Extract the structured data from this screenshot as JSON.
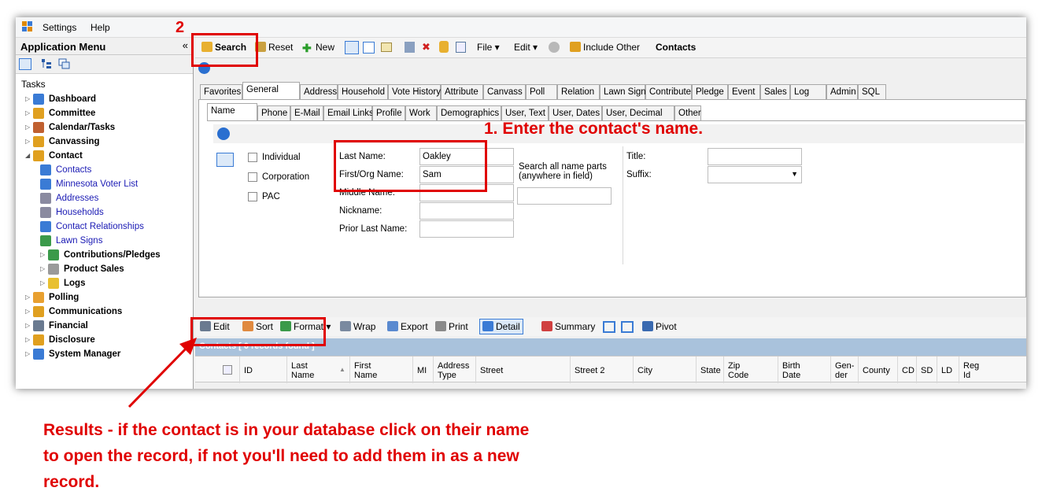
{
  "menu": {
    "settings": "Settings",
    "help": "Help"
  },
  "left": {
    "title": "Application Menu",
    "collapse": "«",
    "tasks": "Tasks",
    "tree": [
      {
        "label": "Dashboard",
        "level": 0,
        "bold": true,
        "exp": "▷"
      },
      {
        "label": "Committee",
        "level": 0,
        "bold": true,
        "exp": "▷"
      },
      {
        "label": "Calendar/Tasks",
        "level": 0,
        "bold": true,
        "exp": "▷"
      },
      {
        "label": "Canvassing",
        "level": 0,
        "bold": true,
        "exp": "▷"
      },
      {
        "label": "Contact",
        "level": 0,
        "bold": true,
        "exp": "◢"
      },
      {
        "label": "Contacts",
        "level": 1,
        "link": true
      },
      {
        "label": "Minnesota Voter List",
        "level": 1,
        "link": true
      },
      {
        "label": "Addresses",
        "level": 1,
        "link": true
      },
      {
        "label": "Households",
        "level": 1,
        "link": true
      },
      {
        "label": "Contact Relationships",
        "level": 1,
        "link": true
      },
      {
        "label": "Lawn Signs",
        "level": 1,
        "link": true
      },
      {
        "label": "Contributions/Pledges",
        "level": 1,
        "bold": true,
        "exp": "▷"
      },
      {
        "label": "Product Sales",
        "level": 1,
        "bold": true,
        "exp": "▷"
      },
      {
        "label": "Logs",
        "level": 1,
        "bold": true,
        "exp": "▷"
      },
      {
        "label": "Polling",
        "level": 0,
        "bold": true,
        "exp": "▷"
      },
      {
        "label": "Communications",
        "level": 0,
        "bold": true,
        "exp": "▷"
      },
      {
        "label": "Financial",
        "level": 0,
        "bold": true,
        "exp": "▷"
      },
      {
        "label": "Disclosure",
        "level": 0,
        "bold": true,
        "exp": "▷"
      },
      {
        "label": "System Manager",
        "level": 0,
        "bold": true,
        "exp": "▷"
      }
    ]
  },
  "toolbar": {
    "search": "Search",
    "reset": "Reset",
    "new": "New",
    "file": "File ▾",
    "edit": "Edit ▾",
    "include_other": "Include Other",
    "contacts": "Contacts"
  },
  "tabs1": [
    "Favorites",
    "General",
    "Address",
    "Household",
    "Vote History",
    "Attribute",
    "Canvass",
    "Poll",
    "Relation",
    "Lawn Sign",
    "Contribute",
    "Pledge",
    "Event",
    "Sales",
    "Log",
    "Admin",
    "SQL"
  ],
  "tabs2": [
    "Name",
    "Phone",
    "E-Mail",
    "Email Links",
    "Profile",
    "Work",
    "Demographics",
    "User, Text",
    "User, Dates",
    "User, Decimal",
    "Other"
  ],
  "form": {
    "individual": "Individual",
    "corporation": "Corporation",
    "pac": "PAC",
    "last_name_label": "Last Name:",
    "last_name_value": "Oakley",
    "first_name_label": "First/Org Name:",
    "first_name_value": "Sam",
    "middle_label": "Middle Name:",
    "nickname_label": "Nickname:",
    "prior_label": "Prior Last Name:",
    "search_all_1": "Search all name parts",
    "search_all_2": "(anywhere in field)",
    "title_label": "Title:",
    "suffix_label": "Suffix:"
  },
  "gridbar": {
    "edit": "Edit",
    "sort": "Sort",
    "format": "Format ▾",
    "wrap": "Wrap",
    "export": "Export",
    "print": "Print",
    "detail": "Detail",
    "summary": "Summary",
    "pivot": "Pivot"
  },
  "grid": {
    "caption": "Contacts [ 0 records found ]",
    "row_number": "0",
    "cols": [
      {
        "a": "ID",
        "b": ""
      },
      {
        "a": "Last",
        "b": "Name"
      },
      {
        "a": "First",
        "b": "Name"
      },
      {
        "a": "MI",
        "b": ""
      },
      {
        "a": "Address",
        "b": "Type"
      },
      {
        "a": "Street",
        "b": ""
      },
      {
        "a": "Street 2",
        "b": ""
      },
      {
        "a": "City",
        "b": ""
      },
      {
        "a": "State",
        "b": ""
      },
      {
        "a": "Zip",
        "b": "Code"
      },
      {
        "a": "Birth",
        "b": "Date"
      },
      {
        "a": "Gen-",
        "b": "der"
      },
      {
        "a": "County",
        "b": ""
      },
      {
        "a": "CD",
        "b": ""
      },
      {
        "a": "SD",
        "b": ""
      },
      {
        "a": "LD",
        "b": ""
      },
      {
        "a": "Reg",
        "b": "Id"
      }
    ]
  },
  "annotations": {
    "step2": "2",
    "step1": "1. Enter the contact's name.",
    "results_1": "Results - if the contact is in your database click on their name",
    "results_2": "to open the record, if not you'll need to add them in as a new",
    "results_3": "record."
  },
  "colors": {
    "annotation": "#e00000",
    "caption_bar": "#a9c2dc",
    "link": "#1a1ab4"
  }
}
